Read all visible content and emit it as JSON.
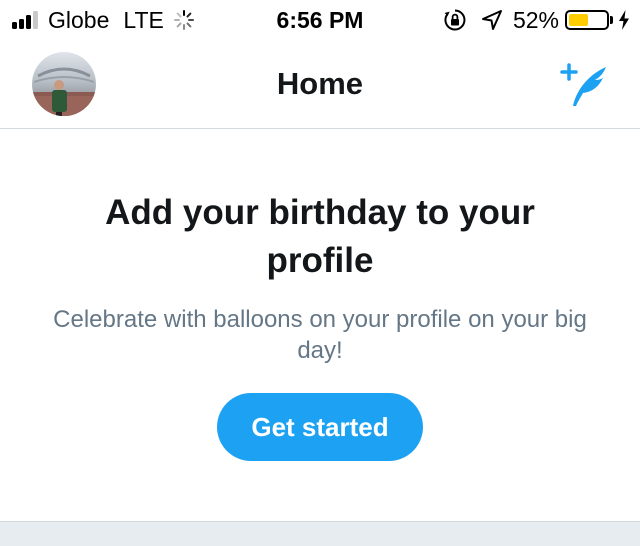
{
  "status_bar": {
    "carrier": "Globe",
    "network": "LTE",
    "time": "6:56 PM",
    "battery_percent": "52%",
    "battery_level": 0.52,
    "signal_bars_filled": 3,
    "signal_bars_total": 4,
    "icons": [
      "signal-icon",
      "loading-spinner-icon",
      "orientation-lock-icon",
      "location-arrow-icon",
      "battery-icon",
      "charging-bolt-icon"
    ],
    "colors": {
      "battery_fill": "#ffcc00"
    }
  },
  "nav": {
    "title": "Home",
    "compose_icon": "compose-tweet-icon",
    "avatar": "profile-avatar"
  },
  "birthday_prompt": {
    "title": "Add your birthday to your profile",
    "description": "Celebrate with balloons on your profile on your big day!",
    "cta_label": "Get started"
  },
  "colors": {
    "accent": "#1da1f2",
    "title_text": "#14171a",
    "secondary_text": "#657786",
    "divider": "#d3d8dd",
    "band": "#e6ecf0"
  }
}
